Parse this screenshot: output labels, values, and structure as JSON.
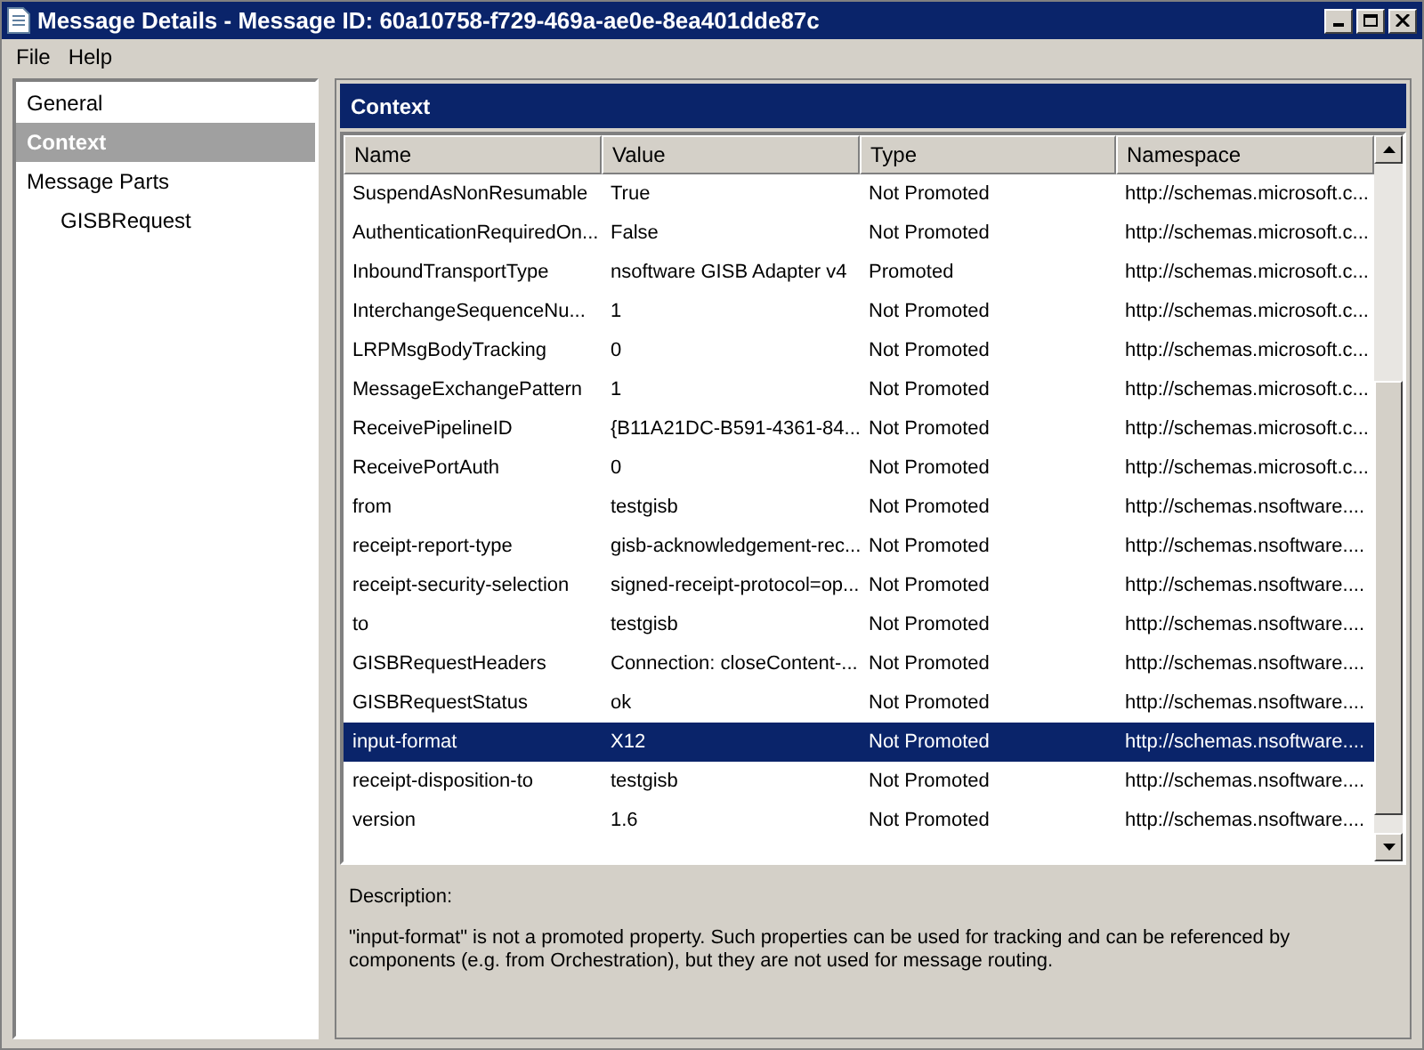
{
  "window": {
    "title": "Message Details - Message ID: 60a10758-f729-469a-ae0e-8ea401dde87c"
  },
  "menu": [
    "File",
    "Help"
  ],
  "sidebar": {
    "items": [
      {
        "label": "General",
        "selected": false
      },
      {
        "label": "Context",
        "selected": true
      },
      {
        "label": "Message Parts",
        "selected": false,
        "children": [
          {
            "label": "GISBRequest",
            "selected": false
          }
        ]
      }
    ]
  },
  "panel": {
    "title": "Context"
  },
  "table": {
    "columns": [
      "Name",
      "Value",
      "Type",
      "Namespace"
    ],
    "rows": [
      {
        "cells": [
          "SuspendAsNonResumable",
          "True",
          "Not Promoted",
          "http://schemas.microsoft.c..."
        ],
        "selected": false
      },
      {
        "cells": [
          "AuthenticationRequiredOn...",
          "False",
          "Not Promoted",
          "http://schemas.microsoft.c..."
        ],
        "selected": false
      },
      {
        "cells": [
          "InboundTransportType",
          "nsoftware GISB Adapter v4",
          "Promoted",
          "http://schemas.microsoft.c..."
        ],
        "selected": false
      },
      {
        "cells": [
          "InterchangeSequenceNu...",
          "1",
          "Not Promoted",
          "http://schemas.microsoft.c..."
        ],
        "selected": false
      },
      {
        "cells": [
          "LRPMsgBodyTracking",
          "0",
          "Not Promoted",
          "http://schemas.microsoft.c..."
        ],
        "selected": false
      },
      {
        "cells": [
          "MessageExchangePattern",
          "1",
          "Not Promoted",
          "http://schemas.microsoft.c..."
        ],
        "selected": false
      },
      {
        "cells": [
          "ReceivePipelineID",
          "{B11A21DC-B591-4361-84...",
          "Not Promoted",
          "http://schemas.microsoft.c..."
        ],
        "selected": false
      },
      {
        "cells": [
          "ReceivePortAuth",
          "0",
          "Not Promoted",
          "http://schemas.microsoft.c..."
        ],
        "selected": false
      },
      {
        "cells": [
          "from",
          "testgisb",
          "Not Promoted",
          "http://schemas.nsoftware...."
        ],
        "selected": false
      },
      {
        "cells": [
          "receipt-report-type",
          "gisb-acknowledgement-rec...",
          "Not Promoted",
          "http://schemas.nsoftware...."
        ],
        "selected": false
      },
      {
        "cells": [
          "receipt-security-selection",
          "signed-receipt-protocol=op...",
          "Not Promoted",
          "http://schemas.nsoftware...."
        ],
        "selected": false
      },
      {
        "cells": [
          "to",
          "testgisb",
          "Not Promoted",
          "http://schemas.nsoftware...."
        ],
        "selected": false
      },
      {
        "cells": [
          "GISBRequestHeaders",
          "Connection: closeContent-...",
          "Not Promoted",
          "http://schemas.nsoftware...."
        ],
        "selected": false
      },
      {
        "cells": [
          "GISBRequestStatus",
          "ok",
          "Not Promoted",
          "http://schemas.nsoftware...."
        ],
        "selected": false
      },
      {
        "cells": [
          "input-format",
          "X12",
          "Not Promoted",
          "http://schemas.nsoftware...."
        ],
        "selected": true
      },
      {
        "cells": [
          "receipt-disposition-to",
          "testgisb",
          "Not Promoted",
          "http://schemas.nsoftware...."
        ],
        "selected": false
      },
      {
        "cells": [
          "version",
          "1.6",
          "Not Promoted",
          "http://schemas.nsoftware...."
        ],
        "selected": false
      }
    ]
  },
  "description": {
    "label": "Description:",
    "text": "\"input-format\" is not a promoted property. Such properties can be used for tracking and can be referenced by components (e.g. from Orchestration), but they are not used for message routing."
  }
}
